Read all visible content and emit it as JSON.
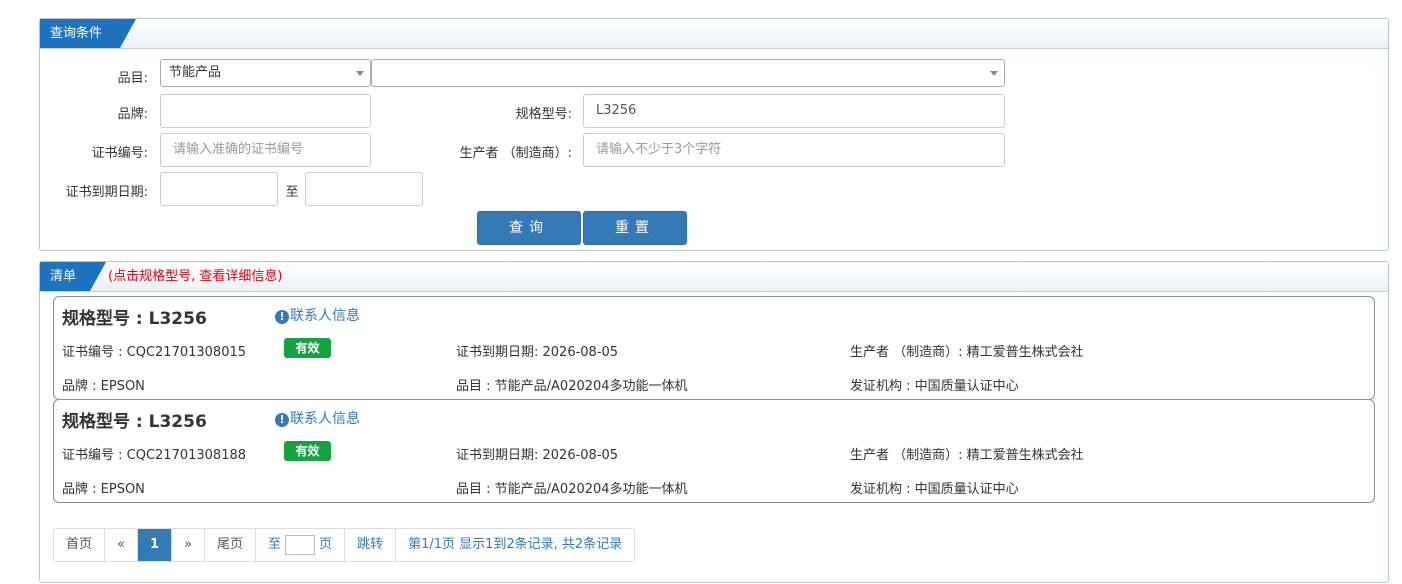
{
  "query_panel": {
    "title": "查询条件",
    "category_label": "品目:",
    "category_value": "节能产品",
    "subcategory_value": "",
    "brand_label": "品牌:",
    "brand_value": "",
    "model_label": "规格型号:",
    "model_value": "L3256",
    "cert_no_label": "证书编号:",
    "cert_no_placeholder": "请输入准确的证书编号",
    "manufacturer_label": "生产者 （制造商）:",
    "manufacturer_placeholder": "请输入不少于3个字符",
    "expiry_label": "证书到期日期:",
    "expiry_from": "",
    "expiry_to_label": "至",
    "expiry_to": "",
    "search_button": "查询",
    "reset_button": "重置"
  },
  "list_panel": {
    "title": "清单",
    "hint": "(点击规格型号, 查看详细信息)",
    "records": [
      {
        "model": "规格型号 : L3256",
        "contact_link": "联系人信息",
        "cert_no": "证书编号 : CQC21701308015",
        "status": "有效",
        "expiry": "证书到期日期: 2026-08-05",
        "manufacturer": "生产者 （制造商）: 精工爱普生株式会社",
        "brand": "品牌 : EPSON",
        "category": "品目 : 节能产品/A020204多功能一体机",
        "issuer": "发证机构 : 中国质量认证中心"
      },
      {
        "model": "规格型号 : L3256",
        "contact_link": "联系人信息",
        "cert_no": "证书编号 : CQC21701308188",
        "status": "有效",
        "expiry": "证书到期日期: 2026-08-05",
        "manufacturer": "生产者 （制造商）: 精工爱普生株式会社",
        "brand": "品牌 : EPSON",
        "category": "品目 : 节能产品/A020204多功能一体机",
        "issuer": "发证机构 : 中国质量认证中心"
      }
    ]
  },
  "pagination": {
    "first": "首页",
    "prev": "«",
    "current": "1",
    "next": "»",
    "last": "尾页",
    "goto_prefix": "至",
    "goto_suffix": "页",
    "jump": "跳转",
    "summary": "第1/1页  显示1到2条记录, 共2条记录"
  },
  "colors": {
    "accent": "#337ab7",
    "tab": "#1e73be",
    "valid_badge": "#14a340",
    "hint_red": "#e60012"
  }
}
